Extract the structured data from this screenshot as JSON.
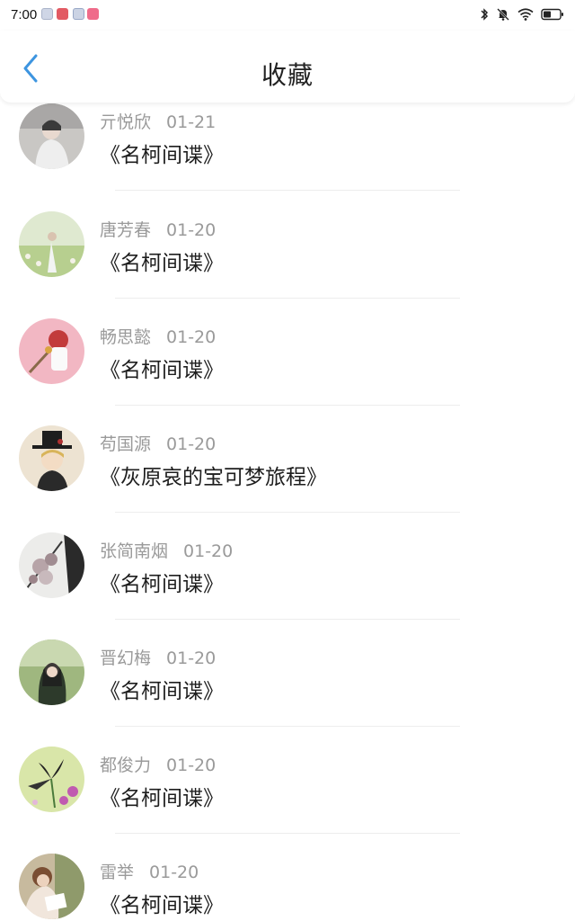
{
  "status": {
    "time": "7:00"
  },
  "header": {
    "title": "收藏"
  },
  "items": [
    {
      "name": "亓悦欣",
      "date": "01-21",
      "book": "《名柯间谍》"
    },
    {
      "name": "唐芳春",
      "date": "01-20",
      "book": "《名柯间谍》"
    },
    {
      "name": "畅思懿",
      "date": "01-20",
      "book": "《名柯间谍》"
    },
    {
      "name": "苟国源",
      "date": "01-20",
      "book": "《灰原哀的宝可梦旅程》"
    },
    {
      "name": "张简南烟",
      "date": "01-20",
      "book": "《名柯间谍》"
    },
    {
      "name": "晋幻梅",
      "date": "01-20",
      "book": "《名柯间谍》"
    },
    {
      "name": "都俊力",
      "date": "01-20",
      "book": "《名柯间谍》"
    },
    {
      "name": "雷举",
      "date": "01-20",
      "book": "《名柯间谍》"
    }
  ]
}
